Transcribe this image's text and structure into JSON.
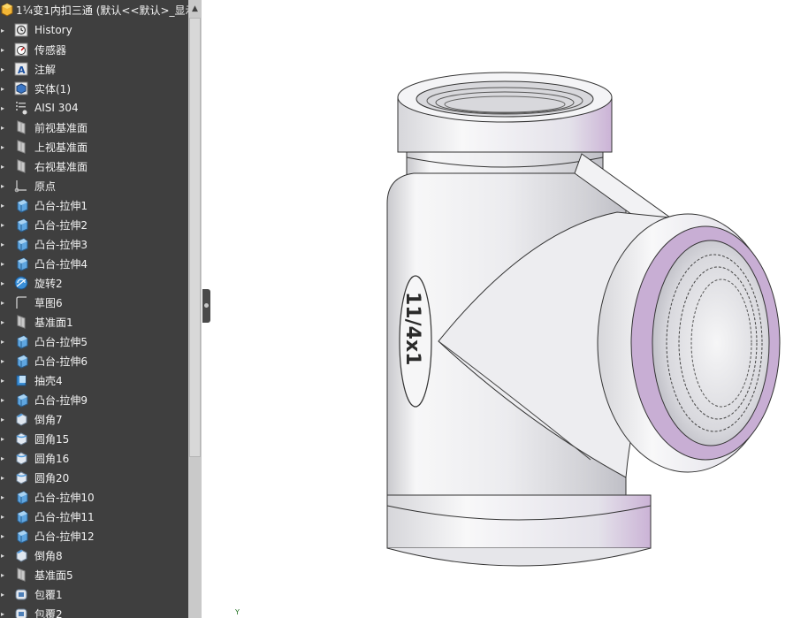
{
  "tree": {
    "title": "1¼变1内扣三通  (默认<<默认>_显示",
    "items": [
      {
        "label": "History",
        "icon": "history-icon"
      },
      {
        "label": "传感器",
        "icon": "sensor-icon"
      },
      {
        "label": "注解",
        "icon": "annotation-icon"
      },
      {
        "label": "实体(1)",
        "icon": "solid-bodies-icon"
      },
      {
        "label": "AISI 304",
        "icon": "material-icon"
      },
      {
        "label": "前视基准面",
        "icon": "plane-icon"
      },
      {
        "label": "上视基准面",
        "icon": "plane-icon"
      },
      {
        "label": "右视基准面",
        "icon": "plane-icon"
      },
      {
        "label": "原点",
        "icon": "origin-icon"
      },
      {
        "label": "凸台-拉伸1",
        "icon": "boss-extrude-icon"
      },
      {
        "label": "凸台-拉伸2",
        "icon": "boss-extrude-icon"
      },
      {
        "label": "凸台-拉伸3",
        "icon": "boss-extrude-icon"
      },
      {
        "label": "凸台-拉伸4",
        "icon": "boss-extrude-icon"
      },
      {
        "label": "旋转2",
        "icon": "revolve-icon"
      },
      {
        "label": "草图6",
        "icon": "sketch-icon"
      },
      {
        "label": "基准面1",
        "icon": "plane-icon"
      },
      {
        "label": "凸台-拉伸5",
        "icon": "boss-extrude-icon"
      },
      {
        "label": "凸台-拉伸6",
        "icon": "boss-extrude-icon"
      },
      {
        "label": "抽壳4",
        "icon": "shell-icon"
      },
      {
        "label": "凸台-拉伸9",
        "icon": "boss-extrude-icon"
      },
      {
        "label": "倒角7",
        "icon": "chamfer-icon"
      },
      {
        "label": "圆角15",
        "icon": "fillet-icon"
      },
      {
        "label": "圆角16",
        "icon": "fillet-icon"
      },
      {
        "label": "圆角20",
        "icon": "fillet-icon"
      },
      {
        "label": "凸台-拉伸10",
        "icon": "boss-extrude-icon"
      },
      {
        "label": "凸台-拉伸11",
        "icon": "boss-extrude-icon"
      },
      {
        "label": "凸台-拉伸12",
        "icon": "boss-extrude-icon"
      },
      {
        "label": "倒角8",
        "icon": "chamfer-icon"
      },
      {
        "label": "基准面5",
        "icon": "plane-icon"
      },
      {
        "label": "包覆1",
        "icon": "wrap-icon"
      },
      {
        "label": "包覆2",
        "icon": "wrap-icon"
      }
    ]
  },
  "viewport": {
    "engraving": "11/4x1",
    "axis_label": "Y"
  },
  "colors": {
    "panel_bg": "#3f3f3f",
    "highlight_purple": "#cdb2d6",
    "metal": "#e9e9ec"
  }
}
